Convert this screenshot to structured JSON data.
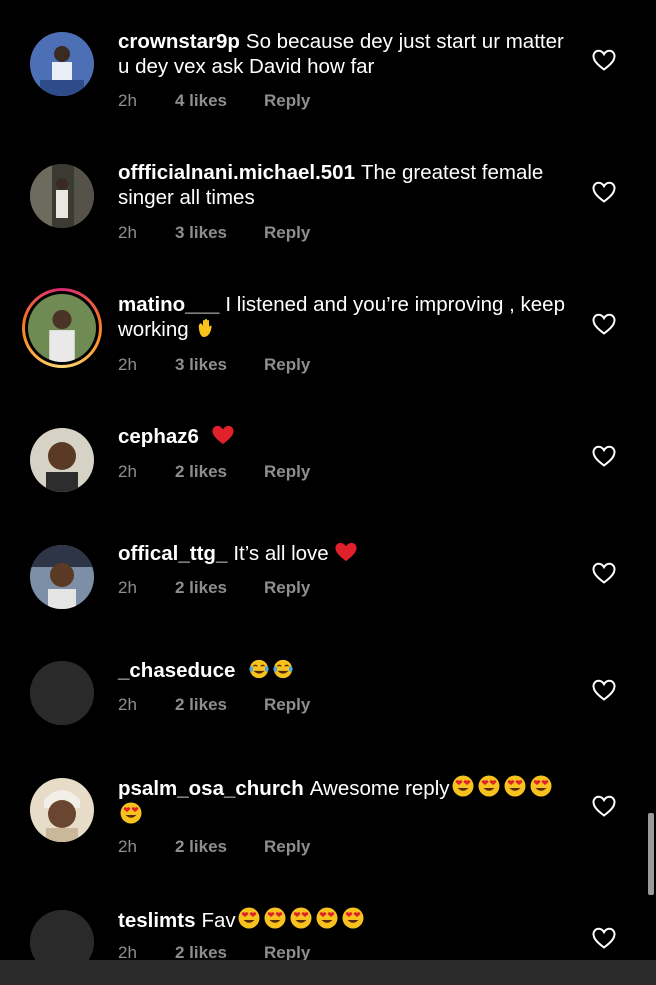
{
  "comments": [
    {
      "username": "crownstar9p",
      "text": "So because dey just start ur matter u dey vex ask David how far",
      "time": "2h",
      "likes": "4 likes",
      "reply": "Reply",
      "emoji": []
    },
    {
      "username": "offficialnani.michael.501",
      "text": "The greatest female singer all times",
      "time": "2h",
      "likes": "3 likes",
      "reply": "Reply",
      "emoji": []
    },
    {
      "username": "matino___",
      "text": "I listened and you’re improving , keep working",
      "time": "2h",
      "likes": "3 likes",
      "reply": "Reply",
      "emoji": [
        "waving-hand"
      ]
    },
    {
      "username": "cephaz6",
      "text": "",
      "time": "2h",
      "likes": "2 likes",
      "reply": "Reply",
      "emoji": [
        "red-heart"
      ]
    },
    {
      "username": "offical_ttg_",
      "text": "It’s all love",
      "time": "2h",
      "likes": "2 likes",
      "reply": "Reply",
      "emoji": [
        "red-heart"
      ]
    },
    {
      "username": "_chaseduce",
      "text": "",
      "time": "2h",
      "likes": "2 likes",
      "reply": "Reply",
      "emoji": [
        "tears-of-joy",
        "tears-of-joy"
      ]
    },
    {
      "username": "psalm_osa_church",
      "text": "Awesome reply",
      "time": "2h",
      "likes": "2 likes",
      "reply": "Reply",
      "emoji": [
        "heart-eyes",
        "heart-eyes",
        "heart-eyes",
        "heart-eyes",
        "heart-eyes"
      ]
    },
    {
      "username": "teslimts",
      "text": "Fav",
      "time": "2h",
      "likes": "2 likes",
      "reply": "Reply",
      "emoji": [
        "heart-eyes",
        "heart-eyes",
        "heart-eyes",
        "heart-eyes",
        "heart-eyes"
      ]
    }
  ],
  "colors": {
    "background": "#000000",
    "meta_text": "#8e8e8e",
    "heart_outline": "#ffffff",
    "ring": "#d62976"
  },
  "icons": {
    "like": "heart-outline-icon"
  }
}
